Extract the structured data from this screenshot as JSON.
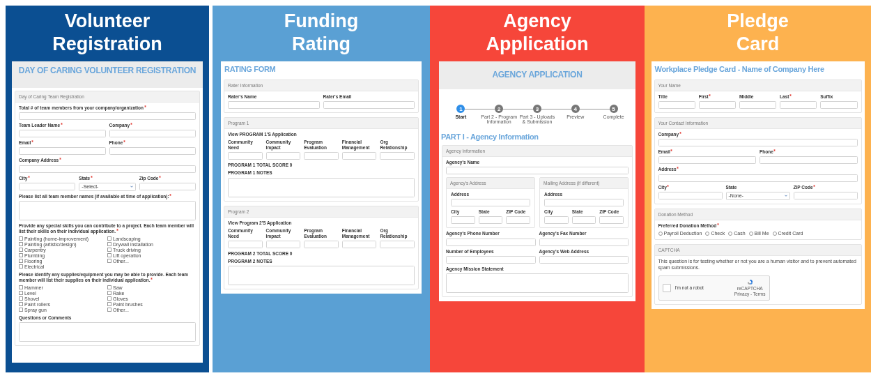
{
  "columns": [
    {
      "heading": [
        "Volunteer",
        "Registration"
      ],
      "color": "#0b4f92",
      "form": [
        {
          "kind": "banner",
          "text": "DAY OF CARING VOLUNTEER REGISTRATION"
        },
        {
          "kind": "panel",
          "heading": "Day of Caring Team Registration",
          "blocks": [
            {
              "kind": "fields",
              "fields": [
                {
                  "label": "Total # of team members from your company/organization",
                  "required": true,
                  "kind": "input"
                }
              ]
            },
            {
              "kind": "fields",
              "fields": [
                {
                  "label": "Team Leader Name",
                  "required": true,
                  "kind": "input"
                },
                {
                  "label": "Company",
                  "required": true,
                  "kind": "input"
                }
              ]
            },
            {
              "kind": "fields",
              "fields": [
                {
                  "label": "Email",
                  "required": true,
                  "kind": "input"
                },
                {
                  "label": "Phone",
                  "required": true,
                  "kind": "input"
                }
              ]
            },
            {
              "kind": "fields",
              "fields": [
                {
                  "label": "Company Address",
                  "required": true,
                  "kind": "input"
                }
              ]
            },
            {
              "kind": "fields",
              "fields": [
                {
                  "label": "City",
                  "required": true,
                  "kind": "input"
                },
                {
                  "label": "State",
                  "required": true,
                  "kind": "select",
                  "value": "-Select-"
                },
                {
                  "label": "Zip Code",
                  "required": true,
                  "kind": "input"
                }
              ]
            },
            {
              "kind": "fields",
              "fields": [
                {
                  "label": "Please list all team member names (if available at time of application):",
                  "required": true,
                  "kind": "textarea"
                }
              ]
            },
            {
              "kind": "checks",
              "question": "Provide any special skills you can contribute to a project. Each team member will list their skills on their individual application.",
              "required": true,
              "options": [
                {
                  "label": "Painting (home-improvement)",
                  "checked": false
                },
                {
                  "label": "Landscaping",
                  "checked": false
                },
                {
                  "label": "Painting (artistic/design)",
                  "checked": false
                },
                {
                  "label": "Drywall installation",
                  "checked": false
                },
                {
                  "label": "Carpentry",
                  "checked": false
                },
                {
                  "label": "Truck driving",
                  "checked": false
                },
                {
                  "label": "Plumbing",
                  "checked": false
                },
                {
                  "label": "Lift operation",
                  "checked": false
                },
                {
                  "label": "Flooring",
                  "checked": false
                },
                {
                  "label": "Other...",
                  "checked": false
                },
                {
                  "label": "Electrical",
                  "checked": false
                }
              ]
            },
            {
              "kind": "checks",
              "question": "Please identify any supplies/equipment you may be able to provide. Each team member will list their supplies on their individual application.",
              "required": true,
              "options": [
                {
                  "label": "Hammer",
                  "checked": false
                },
                {
                  "label": "Saw",
                  "checked": false
                },
                {
                  "label": "Level",
                  "checked": false
                },
                {
                  "label": "Rake",
                  "checked": false
                },
                {
                  "label": "Shovel",
                  "checked": false
                },
                {
                  "label": "Gloves",
                  "checked": false
                },
                {
                  "label": "Paint rollers",
                  "checked": false
                },
                {
                  "label": "Paint brushes",
                  "checked": false
                },
                {
                  "label": "Spray gun",
                  "checked": false
                },
                {
                  "label": "Other...",
                  "checked": false
                }
              ]
            },
            {
              "kind": "fields",
              "fields": [
                {
                  "label": "Questions or Comments",
                  "required": false,
                  "kind": "textarea"
                }
              ]
            }
          ]
        }
      ]
    },
    {
      "heading": [
        "Funding",
        "Rating"
      ],
      "color": "#5aa0d4",
      "form": [
        {
          "kind": "title",
          "text": "RATING FORM"
        },
        {
          "kind": "panel",
          "heading": "Rater Information",
          "blocks": [
            {
              "kind": "fields",
              "fields": [
                {
                  "label": "Rater's Name",
                  "required": false,
                  "kind": "input"
                },
                {
                  "label": "Rater's Email",
                  "required": false,
                  "kind": "input"
                }
              ]
            }
          ]
        },
        {
          "kind": "panel",
          "heading": "Program 1",
          "blocks": [
            {
              "kind": "note",
              "text": "View PROGRAM 1'S Application"
            },
            {
              "kind": "fields",
              "fields": [
                {
                  "label": "Community Need",
                  "required": false,
                  "kind": "input"
                },
                {
                  "label": "Community Impact",
                  "required": false,
                  "kind": "input"
                },
                {
                  "label": "Program Evaluation",
                  "required": false,
                  "kind": "input"
                },
                {
                  "label": "Financial Management",
                  "required": false,
                  "kind": "input"
                },
                {
                  "label": "Org Relationship",
                  "required": false,
                  "kind": "input"
                }
              ]
            },
            {
              "kind": "note",
              "text": "PROGRAM 1 TOTAL SCORE 0"
            },
            {
              "kind": "fields",
              "fields": [
                {
                  "label": "PROGRAM 1 NOTES",
                  "required": false,
                  "kind": "textarea"
                }
              ]
            }
          ]
        },
        {
          "kind": "panel",
          "heading": "Program 2",
          "blocks": [
            {
              "kind": "note",
              "text": "View Program 2'S Application"
            },
            {
              "kind": "fields",
              "fields": [
                {
                  "label": "Community Need",
                  "required": false,
                  "kind": "input"
                },
                {
                  "label": "Community Impact",
                  "required": false,
                  "kind": "input"
                },
                {
                  "label": "Program Evaluation",
                  "required": false,
                  "kind": "input"
                },
                {
                  "label": "Financial Management",
                  "required": false,
                  "kind": "input"
                },
                {
                  "label": "Org Relationship",
                  "required": false,
                  "kind": "input"
                }
              ]
            },
            {
              "kind": "note",
              "text": "PROGRAM 2 TOTAL SCORE 0"
            },
            {
              "kind": "fields",
              "fields": [
                {
                  "label": "PROGRAM 2 NOTES",
                  "required": false,
                  "kind": "textarea"
                }
              ]
            }
          ]
        }
      ]
    },
    {
      "heading": [
        "Agency",
        "Application"
      ],
      "color": "#f6463a",
      "form": [
        {
          "kind": "banner",
          "text": "AGENCY APPLICATION"
        },
        {
          "kind": "stepper",
          "steps": [
            {
              "number": "1",
              "label": "Start",
              "selected": true
            },
            {
              "number": "2",
              "label": "Part 2 - Program Information",
              "selected": false
            },
            {
              "number": "3",
              "label": "Part 3 - Uploads & Submission",
              "selected": false
            },
            {
              "number": "4",
              "label": "Preview",
              "selected": false
            },
            {
              "number": "5",
              "label": "Complete",
              "selected": false
            }
          ]
        },
        {
          "kind": "section_title",
          "text": "PART I - Agency Information"
        },
        {
          "kind": "panel",
          "heading": "Agency Information",
          "blocks": [
            {
              "kind": "fields",
              "fields": [
                {
                  "label": "Agency's Name",
                  "required": false,
                  "kind": "input"
                }
              ]
            },
            {
              "kind": "columns",
              "panels": [
                {
                  "heading": "Agency's Address",
                  "blocks": [
                    {
                      "kind": "fields",
                      "fields": [
                        {
                          "label": "Address",
                          "required": false,
                          "kind": "input"
                        }
                      ]
                    },
                    {
                      "kind": "fields",
                      "fields": [
                        {
                          "label": "City",
                          "required": false,
                          "kind": "input"
                        },
                        {
                          "label": "State",
                          "required": false,
                          "kind": "input"
                        },
                        {
                          "label": "ZIP Code",
                          "required": false,
                          "kind": "input"
                        }
                      ]
                    }
                  ]
                },
                {
                  "heading": "Mailing Address (if different)",
                  "blocks": [
                    {
                      "kind": "fields",
                      "fields": [
                        {
                          "label": "Address",
                          "required": false,
                          "kind": "input"
                        }
                      ]
                    },
                    {
                      "kind": "fields",
                      "fields": [
                        {
                          "label": "City",
                          "required": false,
                          "kind": "input"
                        },
                        {
                          "label": "State",
                          "required": false,
                          "kind": "input"
                        },
                        {
                          "label": "ZIP Code",
                          "required": false,
                          "kind": "input"
                        }
                      ]
                    }
                  ]
                }
              ]
            },
            {
              "kind": "fields",
              "fields": [
                {
                  "label": "Agency's Phone Number",
                  "required": false,
                  "kind": "input"
                },
                {
                  "label": "Agency's Fax Number",
                  "required": false,
                  "kind": "input"
                }
              ]
            },
            {
              "kind": "fields",
              "fields": [
                {
                  "label": "Number of Employees",
                  "required": false,
                  "kind": "input"
                },
                {
                  "label": "Agency's Web Address",
                  "required": false,
                  "kind": "input"
                }
              ]
            },
            {
              "kind": "fields",
              "fields": [
                {
                  "label": "Agency Mission Statement",
                  "required": false,
                  "kind": "textarea"
                }
              ]
            }
          ]
        }
      ]
    },
    {
      "heading": [
        "Pledge",
        "Card"
      ],
      "color": "#fdb24f",
      "form": [
        {
          "kind": "title",
          "text": "Workplace Pledge Card - Name of Company Here"
        },
        {
          "kind": "panel",
          "heading": "Your Name",
          "blocks": [
            {
              "kind": "fields",
              "fields": [
                {
                  "label": "Title",
                  "required": false,
                  "kind": "input"
                },
                {
                  "label": "First",
                  "required": true,
                  "kind": "input"
                },
                {
                  "label": "Middle",
                  "required": false,
                  "kind": "input"
                },
                {
                  "label": "Last",
                  "required": true,
                  "kind": "input"
                },
                {
                  "label": "Suffix",
                  "required": false,
                  "kind": "input"
                }
              ]
            }
          ]
        },
        {
          "kind": "panel",
          "heading": "Your Contact Information",
          "blocks": [
            {
              "kind": "fields",
              "fields": [
                {
                  "label": "Company",
                  "required": true,
                  "kind": "input"
                }
              ]
            },
            {
              "kind": "fields",
              "fields": [
                {
                  "label": "Email",
                  "required": true,
                  "kind": "input"
                },
                {
                  "label": "Phone",
                  "required": true,
                  "kind": "input"
                }
              ]
            },
            {
              "kind": "fields",
              "fields": [
                {
                  "label": "Address",
                  "required": true,
                  "kind": "input"
                }
              ]
            },
            {
              "kind": "fields",
              "fields": [
                {
                  "label": "City",
                  "required": true,
                  "kind": "input"
                },
                {
                  "label": "State",
                  "required": false,
                  "kind": "select",
                  "value": "-None-"
                },
                {
                  "label": "ZIP Code",
                  "required": true,
                  "kind": "input"
                }
              ]
            }
          ]
        },
        {
          "kind": "panel",
          "heading": "Donation Method",
          "blocks": [
            {
              "kind": "radios",
              "question": "Preferred Donation Method",
              "required": true,
              "options": [
                {
                  "label": "Payroll Deduction",
                  "selected": false
                },
                {
                  "label": "Check",
                  "selected": false
                },
                {
                  "label": "Cash",
                  "selected": false
                },
                {
                  "label": "Bill Me",
                  "selected": false
                },
                {
                  "label": "Credit Card",
                  "selected": false
                }
              ]
            }
          ]
        },
        {
          "kind": "panel",
          "heading": "CAPTCHA",
          "blocks": [
            {
              "kind": "text",
              "text": "This question is for testing whether or not you are a human visitor and to prevent automated spam submissions."
            },
            {
              "kind": "captcha",
              "label": "I'm not a robot",
              "checked": false,
              "brand": "reCAPTCHA",
              "links": "Privacy - Terms"
            }
          ]
        }
      ]
    }
  ]
}
